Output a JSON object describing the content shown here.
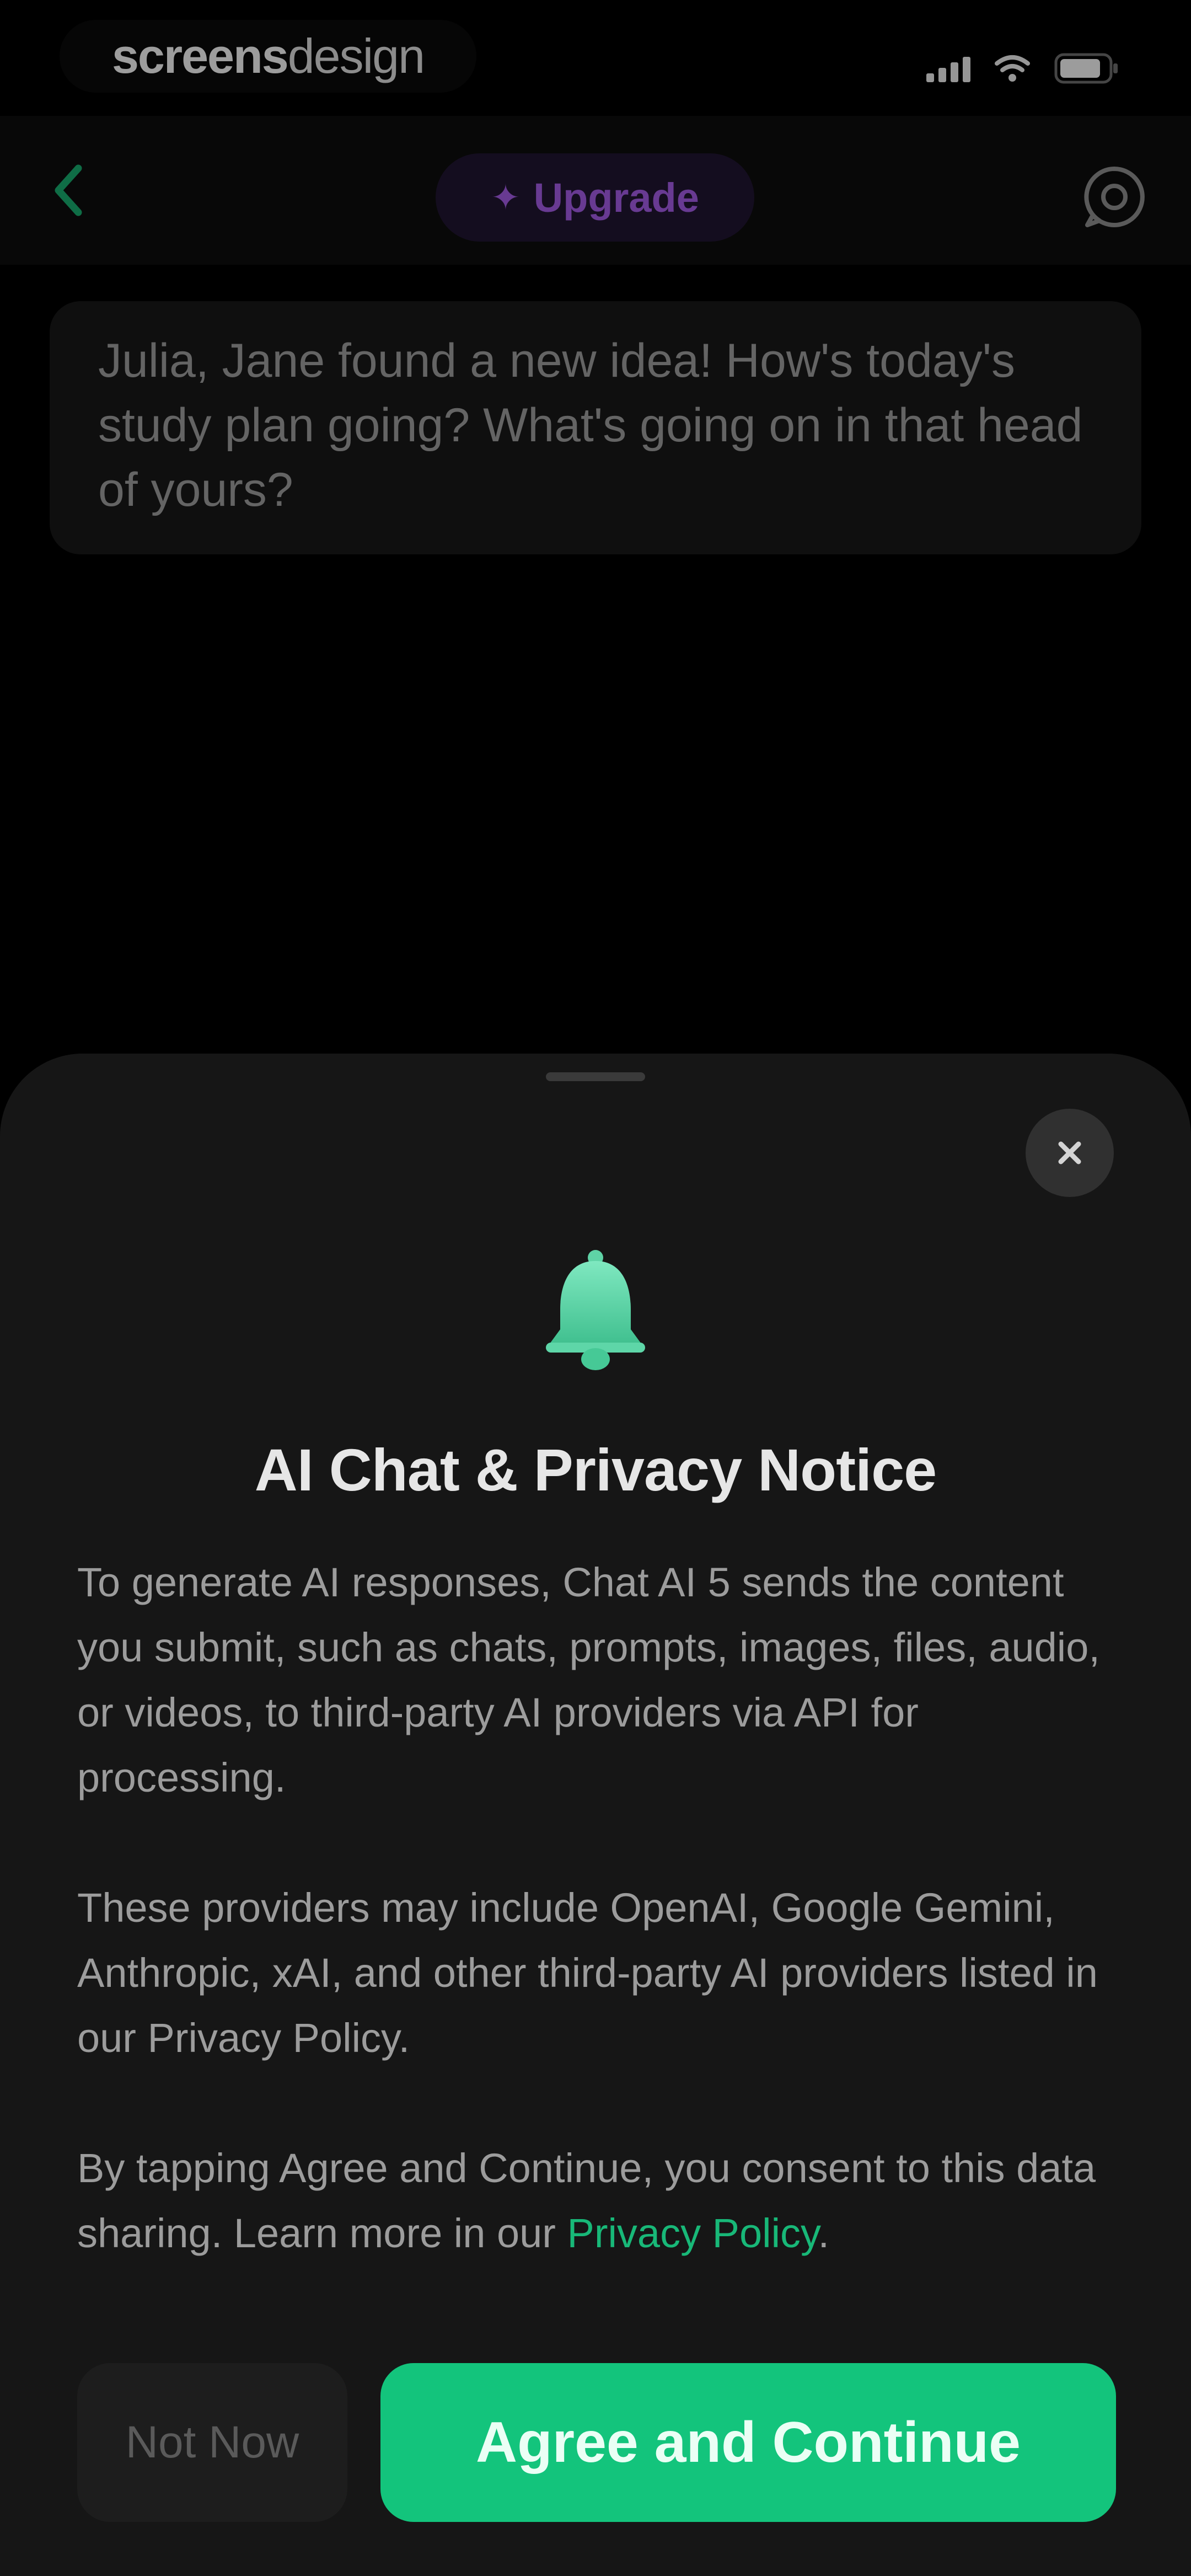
{
  "status_bar": {
    "brand_bold": "screens",
    "brand_light": "design",
    "signal_icon": "cellular-signal-icon",
    "wifi_icon": "wifi-icon",
    "battery_icon": "battery-icon"
  },
  "nav": {
    "back_icon": "chevron-left-icon",
    "upgrade_icon": "sparkle-icon",
    "upgrade_label": "Upgrade",
    "history_icon": "chat-history-icon"
  },
  "chat": {
    "message": "Julia, Jane found a new idea! How's today's study plan going? What's going on in that head of yours?"
  },
  "sheet": {
    "icon": "bell-icon",
    "title": "AI Chat & Privacy Notice",
    "paragraph_1": "To generate AI responses, Chat AI 5 sends the content you submit, such as chats, prompts, images, files, audio, or videos, to third-party AI providers via API for processing.",
    "paragraph_2": "These providers may include OpenAI, Google Gemini, Anthropic, xAI, and other third-party AI providers listed in our Privacy Policy.",
    "paragraph_3_prefix": "By tapping Agree and Continue, you consent to this data sharing. Learn more in our ",
    "privacy_link": "Privacy Policy",
    "paragraph_3_suffix": ".",
    "not_now_label": "Not Now",
    "agree_label": "Agree and Continue"
  },
  "colors": {
    "accent_green": "#13c47c",
    "upgrade_purple": "#a05ae0",
    "background": "#000000",
    "sheet_background": "#161616"
  }
}
